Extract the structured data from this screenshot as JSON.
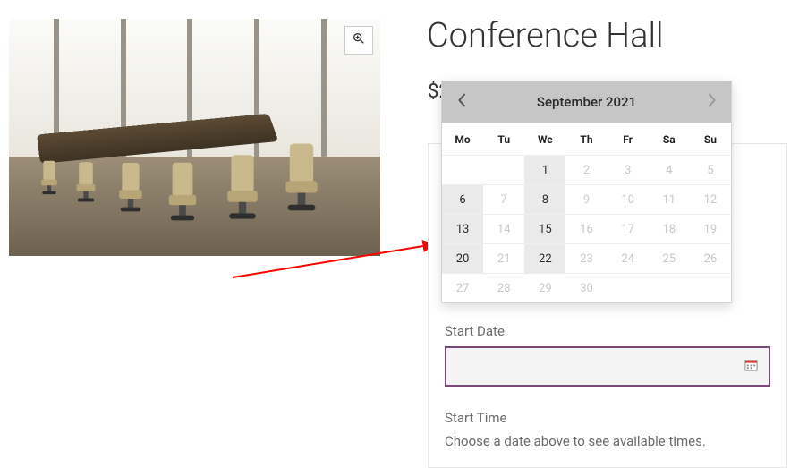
{
  "product": {
    "title": "Conference Hall",
    "price_visible": "$2",
    "image_alt": "Conference room with long wooden table and office chairs"
  },
  "form": {
    "start_date_label": "Start Date",
    "start_date_value": "",
    "start_time_label": "Start Time",
    "start_time_help": "Choose a date above to see available times."
  },
  "calendar": {
    "month_label": "September 2021",
    "dow": [
      "Mo",
      "Tu",
      "We",
      "Th",
      "Fr",
      "Sa",
      "Su"
    ],
    "weeks": [
      [
        {
          "n": "",
          "state": "empty"
        },
        {
          "n": "",
          "state": "empty"
        },
        {
          "n": "1",
          "state": "avail"
        },
        {
          "n": "2",
          "state": "disabled"
        },
        {
          "n": "3",
          "state": "disabled"
        },
        {
          "n": "4",
          "state": "disabled"
        },
        {
          "n": "5",
          "state": "disabled"
        }
      ],
      [
        {
          "n": "6",
          "state": "avail"
        },
        {
          "n": "7",
          "state": "disabled"
        },
        {
          "n": "8",
          "state": "avail"
        },
        {
          "n": "9",
          "state": "disabled"
        },
        {
          "n": "10",
          "state": "disabled"
        },
        {
          "n": "11",
          "state": "disabled"
        },
        {
          "n": "12",
          "state": "disabled"
        }
      ],
      [
        {
          "n": "13",
          "state": "avail"
        },
        {
          "n": "14",
          "state": "disabled"
        },
        {
          "n": "15",
          "state": "avail"
        },
        {
          "n": "16",
          "state": "disabled"
        },
        {
          "n": "17",
          "state": "disabled"
        },
        {
          "n": "18",
          "state": "disabled"
        },
        {
          "n": "19",
          "state": "disabled"
        }
      ],
      [
        {
          "n": "20",
          "state": "avail"
        },
        {
          "n": "21",
          "state": "disabled"
        },
        {
          "n": "22",
          "state": "avail"
        },
        {
          "n": "23",
          "state": "disabled"
        },
        {
          "n": "24",
          "state": "disabled"
        },
        {
          "n": "25",
          "state": "disabled"
        },
        {
          "n": "26",
          "state": "disabled"
        }
      ],
      [
        {
          "n": "27",
          "state": "disabled"
        },
        {
          "n": "28",
          "state": "disabled"
        },
        {
          "n": "29",
          "state": "disabled"
        },
        {
          "n": "30",
          "state": "disabled"
        },
        {
          "n": "",
          "state": "empty"
        },
        {
          "n": "",
          "state": "empty"
        },
        {
          "n": "",
          "state": "empty"
        }
      ]
    ]
  },
  "colors": {
    "input_border": "#7a4a7a",
    "cal_header_bg": "#c6c6c6",
    "avail_bg": "#eaeaea",
    "arrow": "#ff0000"
  }
}
